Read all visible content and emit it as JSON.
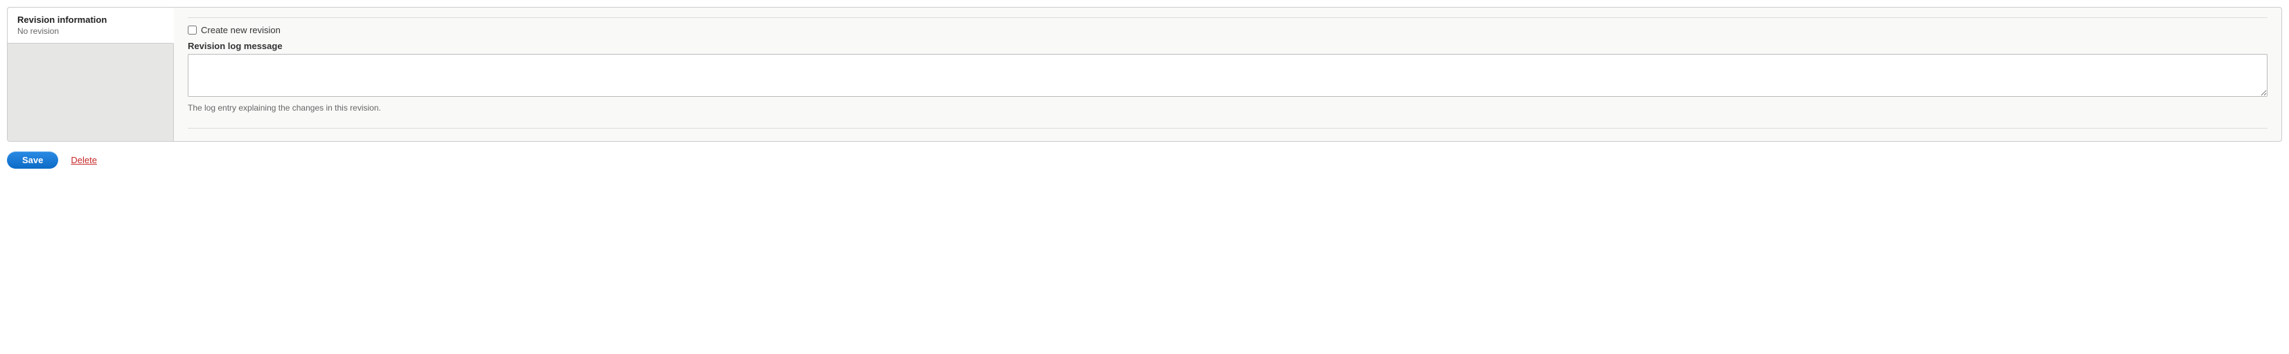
{
  "sidebar": {
    "tabs": [
      {
        "title": "Revision information",
        "summary": "No revision"
      }
    ]
  },
  "revision": {
    "checkbox_label": "Create new revision",
    "checkbox_checked": false,
    "log_label": "Revision log message",
    "log_value": "",
    "log_description": "The log entry explaining the changes in this revision."
  },
  "actions": {
    "save_label": "Save",
    "delete_label": "Delete"
  }
}
